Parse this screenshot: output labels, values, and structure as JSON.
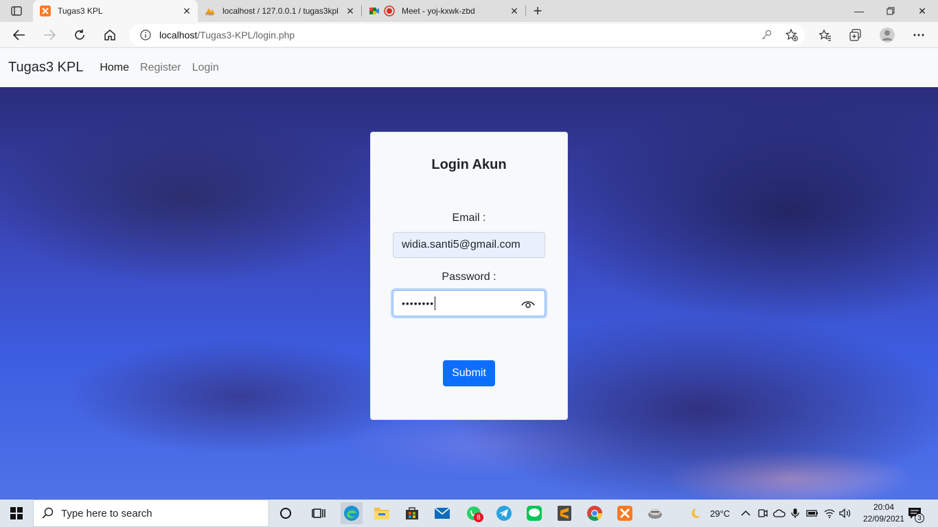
{
  "browser": {
    "tabs": [
      {
        "title": "Tugas3 KPL",
        "active": true
      },
      {
        "title": "localhost / 127.0.0.1 / tugas3kpl",
        "active": false
      },
      {
        "title": "Meet - yoj-kxwk-zbd",
        "active": false
      }
    ],
    "address": {
      "host": "localhost",
      "path": "/Tugas3-KPL/login.php"
    }
  },
  "navbar": {
    "brand": "Tugas3 KPL",
    "links": [
      {
        "label": "Home",
        "active": true
      },
      {
        "label": "Register",
        "active": false
      },
      {
        "label": "Login",
        "active": false
      }
    ]
  },
  "login": {
    "title": "Login Akun",
    "email_label": "Email :",
    "email_value": "widia.santi5@gmail.com",
    "password_label": "Password :",
    "password_value": "••••••••",
    "submit_label": "Submit"
  },
  "taskbar": {
    "search_placeholder": "Type here to search",
    "whatsapp_badge": "8",
    "temperature": "29°C",
    "time": "20:04",
    "date": "22/09/2021",
    "notifications": "3"
  },
  "colors": {
    "primary": "#0d6efd",
    "navbar_bg": "#f8f9fa"
  }
}
